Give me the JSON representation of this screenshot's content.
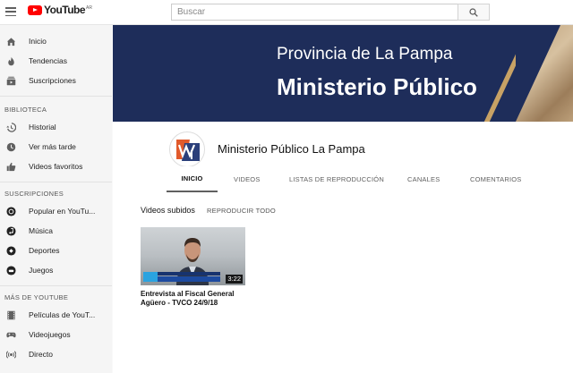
{
  "topbar": {
    "logo_text": "YouTube",
    "country": "AR",
    "search_placeholder": "Buscar"
  },
  "sidebar": {
    "main": [
      {
        "label": "Inicio",
        "icon": "home-icon"
      },
      {
        "label": "Tendencias",
        "icon": "flame-icon"
      },
      {
        "label": "Suscripciones",
        "icon": "subscriptions-icon"
      }
    ],
    "library_heading": "BIBLIOTECA",
    "library": [
      {
        "label": "Historial",
        "icon": "history-icon"
      },
      {
        "label": "Ver más tarde",
        "icon": "clock-icon"
      },
      {
        "label": "Videos favoritos",
        "icon": "thumbs-up-icon"
      }
    ],
    "subs_heading": "SUSCRIPCIONES",
    "subs": [
      {
        "label": "Popular en YouTu...",
        "icon": "popular-icon"
      },
      {
        "label": "Música",
        "icon": "music-icon"
      },
      {
        "label": "Deportes",
        "icon": "sports-icon"
      },
      {
        "label": "Juegos",
        "icon": "games-icon"
      }
    ],
    "more_heading": "MÁS DE YOUTUBE",
    "more": [
      {
        "label": "Películas de YouT...",
        "icon": "film-icon"
      },
      {
        "label": "Videojuegos",
        "icon": "gamepad-icon"
      },
      {
        "label": "Directo",
        "icon": "live-icon"
      }
    ]
  },
  "banner": {
    "line1": "Provincia de La Pampa",
    "line2": "Ministerio Público"
  },
  "channel": {
    "name": "Ministerio Público La Pampa",
    "tabs": [
      "INICIO",
      "VIDEOS",
      "LISTAS DE REPRODUCCIÓN",
      "CANALES",
      "COMENTARIOS"
    ],
    "active_tab": "INICIO"
  },
  "content": {
    "section_title": "Videos subidos",
    "play_all": "REPRODUCIR TODO",
    "video": {
      "title": "Entrevista al Fiscal General Agüero - TVCO 24/9/18",
      "duration": "3:22"
    }
  },
  "colors": {
    "youtube_red": "#ff0000",
    "banner_blue": "#1e2d5a"
  }
}
